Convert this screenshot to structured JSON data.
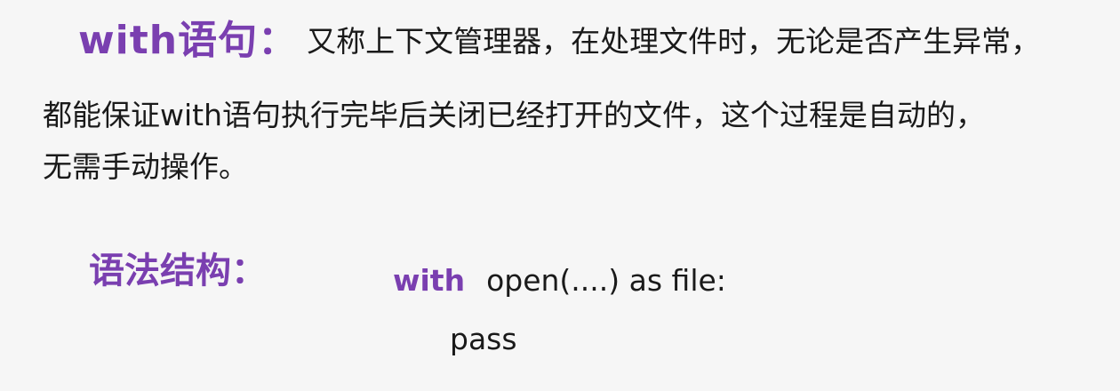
{
  "definition": {
    "term": "with语句：",
    "line1": "又称上下文管理器，在处理文件时，无论是否产生异常，",
    "line2": "都能保证with语句执行完毕后关闭已经打开的文件，这个过程是自动的，",
    "line3": "无需手动操作。"
  },
  "syntax": {
    "label": "语法结构：",
    "keyword": "with",
    "line1_rest": "open(....) as  file:",
    "line2": "pass"
  },
  "colors": {
    "accent": "#7a3fb0",
    "text": "#1a1a1a",
    "background": "#f6f6f6"
  }
}
